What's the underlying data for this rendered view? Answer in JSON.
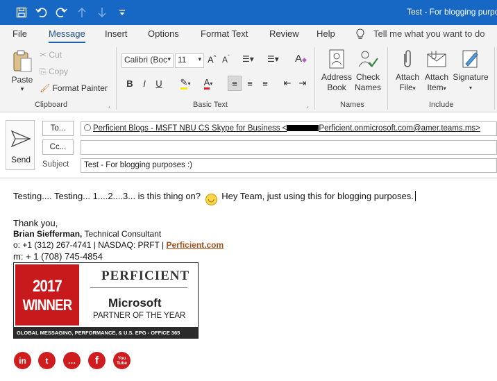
{
  "window": {
    "title": "Test - For blogging purpo"
  },
  "qat": {
    "icons": [
      "save-icon",
      "undo-icon",
      "redo-icon",
      "up-arrow-icon",
      "down-arrow-icon",
      "customize-icon"
    ]
  },
  "tabs": [
    "File",
    "Message",
    "Insert",
    "Options",
    "Format Text",
    "Review",
    "Help"
  ],
  "tell_me": "Tell me what you want to do",
  "ribbon": {
    "clipboard": {
      "label": "Clipboard",
      "paste": "Paste",
      "cut": "Cut",
      "copy": "Copy",
      "format_painter": "Format Painter"
    },
    "basic_text": {
      "label": "Basic Text",
      "font_name": "Calibri (Boc",
      "font_size": "11"
    },
    "names": {
      "label": "Names",
      "address_book_1": "Address",
      "address_book_2": "Book",
      "check_names_1": "Check",
      "check_names_2": "Names"
    },
    "include": {
      "label": "Include",
      "attach_file_1": "Attach",
      "attach_file_2": "File",
      "attach_item_1": "Attach",
      "attach_item_2": "Item",
      "signature_1": "Signature"
    }
  },
  "compose": {
    "send_label": "Send",
    "to_label": "To...",
    "cc_label": "Cc...",
    "subject_label": "Subject",
    "to_value": "Perficient Blogs - MSFT NBU CS Skype for Business <",
    "to_value_tail": "Perficient.onmicrosoft.com@amer.teams.ms>",
    "cc_value": "",
    "subject_value": "Test - For blogging purposes :)"
  },
  "body": {
    "line1a": "Testing.... Testing... 1....2....3... is this thing on?",
    "line1b": "Hey Team, just using this for blogging purposes.",
    "thanks": "Thank you,",
    "sig_name": "Brian Siefferman,",
    "sig_title": "Technical Consultant",
    "sig_phone": "o: +1 (312) 267-4741  |  NASDAQ: PRFT  |",
    "sig_link": "Perficient.com",
    "sig_mobile": "m: + 1 (708) 745-4854"
  },
  "banner": {
    "year": "2017",
    "winner": "WINNER",
    "logo": "PERFICIENT",
    "microsoft": "Microsoft",
    "partner": "PARTNER OF THE YEAR",
    "footer": "GLOBAL MESSAGING, PERFORMANCE, & U.S. EPG - OFFICE 365"
  },
  "social": [
    {
      "name": "linkedin-icon",
      "text": "in"
    },
    {
      "name": "twitter-icon",
      "text": "t"
    },
    {
      "name": "chat-icon",
      "text": "…"
    },
    {
      "name": "facebook-icon",
      "text": "f"
    },
    {
      "name": "youtube-icon",
      "text": "You Tube"
    }
  ],
  "colors": {
    "titlebar": "#1668c4",
    "accent": "#1d5fa8",
    "banner_red": "#c8191d",
    "social_red": "#d01c1f",
    "link": "#a4501b"
  }
}
